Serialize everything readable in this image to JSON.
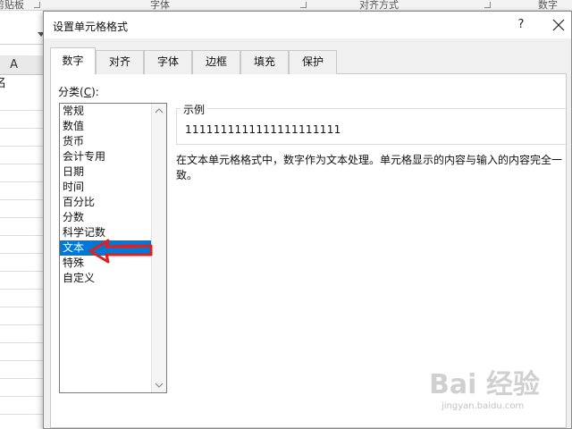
{
  "ribbon": {
    "groups": [
      "剪贴板",
      "字体",
      "对齐方式",
      "数字"
    ]
  },
  "sheet": {
    "column_header": "A",
    "cell_a1": "名"
  },
  "dialog": {
    "title": "设置单元格格式",
    "help": "?",
    "tabs": [
      {
        "label": "数字",
        "active": true
      },
      {
        "label": "对齐",
        "active": false
      },
      {
        "label": "字体",
        "active": false
      },
      {
        "label": "边框",
        "active": false
      },
      {
        "label": "填充",
        "active": false
      },
      {
        "label": "保护",
        "active": false
      }
    ],
    "category_label_prefix": "分类(",
    "category_label_key": "C",
    "category_label_suffix": "):",
    "categories": [
      "常规",
      "数值",
      "货币",
      "会计专用",
      "日期",
      "时间",
      "百分比",
      "分数",
      "科学记数",
      "文本",
      "特殊",
      "自定义"
    ],
    "selected_category": "文本",
    "sample_label": "示例",
    "sample_value": "1111111111111111111111",
    "description": "在文本单元格格式中，数字作为文本处理。单元格显示的内容与输入的内容完全一致。"
  },
  "watermark": {
    "logo": "Bai 经验",
    "url": "jingyan.baidu.com"
  },
  "colors": {
    "selection": "#0078d7",
    "annotation_arrow": "#e02020"
  }
}
